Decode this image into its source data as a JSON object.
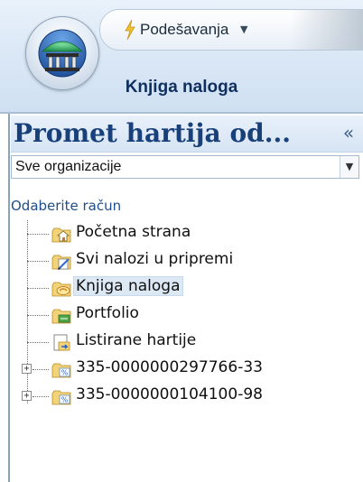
{
  "ribbon": {
    "quick_access_label": "Podešavanja",
    "title": "Knjiga naloga"
  },
  "panel": {
    "title": "Promet hartija od...",
    "collapse_glyph": "«"
  },
  "org_select": {
    "value": "Sve organizacije",
    "arrow_glyph": "▼"
  },
  "tree_heading": "Odaberite račun",
  "tree": {
    "items": [
      {
        "label": "Početna strana",
        "icon": "home-icon",
        "expandable": false,
        "selected": false
      },
      {
        "label": "Svi nalozi u pripremi",
        "icon": "edit-document-icon",
        "expandable": false,
        "selected": false
      },
      {
        "label": "Knjiga naloga",
        "icon": "order-book-icon",
        "expandable": false,
        "selected": true
      },
      {
        "label": "Portfolio",
        "icon": "portfolio-icon",
        "expandable": false,
        "selected": false
      },
      {
        "label": "Listirane hartije",
        "icon": "listed-securities-icon",
        "expandable": false,
        "selected": false
      },
      {
        "label": "335-0000000297766-33",
        "icon": "account-percent-icon",
        "expandable": true,
        "selected": false
      },
      {
        "label": "335-0000000104100-98",
        "icon": "account-percent-icon",
        "expandable": true,
        "selected": false
      }
    ]
  },
  "colors": {
    "panel_title": "#18407a",
    "selected_bg": "#dde8f5",
    "link_text": "#1e4e8c"
  }
}
